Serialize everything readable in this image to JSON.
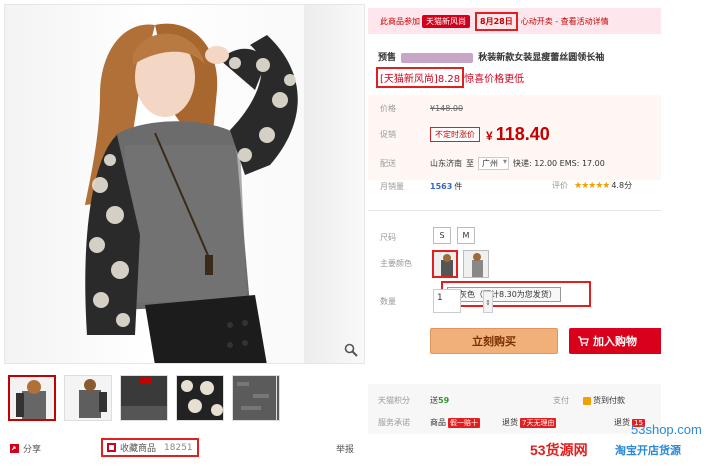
{
  "promo": {
    "prefix": "此商品参加",
    "tag": "天猫新风尚",
    "date": "8月28日",
    "suffix": "心动开卖 - 查看活动详情"
  },
  "product": {
    "title_prefix": "预售",
    "title_text": "秋装新款女装显瘦蕾丝圆领长袖",
    "subtitle_boxed": "[天猫新风尚]",
    "subtitle_rest": "8.28",
    "subtitle_trail": "惊喜价格更低"
  },
  "pricing": {
    "orig_label": "价格",
    "orig_currency": "¥",
    "orig_value": "148.00",
    "promo_label": "促销",
    "promo_tag": "不定时涨价",
    "currency": "¥",
    "price": "118.40",
    "ship_label": "配送",
    "ship_from": "山东济南",
    "ship_to_word": "至",
    "ship_to": "广州",
    "ship_fees": "快递: 12.00 EMS: 17.00",
    "sales_label": "月销量",
    "sales_count": "1563",
    "sales_unit": "件",
    "rating_label": "评价",
    "rating_stars": "★★★★★",
    "rating_score": "4.8分"
  },
  "options": {
    "size_label": "尺码",
    "sizes": [
      "S",
      "M"
    ],
    "color_label": "主要颜色",
    "color_tooltip": "深灰色（预计8.30为您发货）",
    "qty_label": "数量",
    "qty_value": "1"
  },
  "actions": {
    "buy": "立刻购买",
    "cart": "加入购物"
  },
  "info": {
    "points_label": "天猫积分",
    "points_prefix": "送",
    "points_value": "59",
    "pay_label": "支付",
    "pay_cod": "货到付款",
    "service_label": "服务承诺",
    "service_goods": "商品",
    "service_tag1": "假一赔十",
    "service_return": "退货",
    "service_tag2": "7天无理由",
    "service_swap": "退货",
    "service_tag3": "15"
  },
  "gallery": {
    "share": "分享",
    "fav": "收藏商品",
    "fav_count": "18251",
    "report": "举报"
  },
  "watermark": {
    "site": "53shop.com",
    "brand": "53货源网",
    "slogan": "淘宝开店货源"
  },
  "colors": {
    "accent_red": "#c40000",
    "highlight_box": "#e02020",
    "buy_button": "#f1b07a",
    "cart_button": "#d9001b",
    "link_blue": "#3366cc"
  }
}
